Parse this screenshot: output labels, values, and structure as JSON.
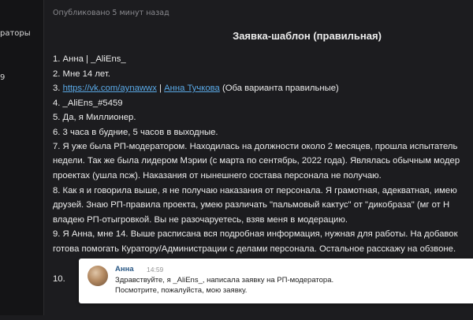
{
  "sidebar": {
    "items": [
      {
        "label": "раторы"
      },
      {
        "label": "9"
      }
    ]
  },
  "post": {
    "meta": "Опубликовано 5 минут назад",
    "title": "Заявка-шаблон (правильная)",
    "lines": [
      "1. Анна | _AliEns_",
      "2. Мне 14 лет.",
      "3. ",
      "4. _AliEns_#5459",
      "5. Да, я Миллионер.",
      "6. 3 часа в будние, 5 часов в выходные.",
      "7. Я уже была РП-модератором. Находилась на должности около 2 месяцев, прошла испытатель",
      "недели. Так же была лидером Мэрии (с марта по сентябрь, 2022 года). Являлась обычным модер",
      "проектах (ушла псж). Наказания от нынешнего состава персонала не получаю.",
      "8. Как я и говорила выше, я не получаю наказания от персонала. Я грамотная, адекватная, имею",
      "друзей. Знаю РП-правила проекта, умею различать \"пальмовый кактус\" от \"дикобраза\"  (мг от Н",
      "владею РП-отыгровкой. Вы не разочаруетесь, взяв меня в модерацию.",
      "9. Я Анна, мне 14. Выше расписана вся подробная информация, нужная для работы. На добавок",
      "готова помогать Куратору/Администрации с делами персонала. Остальное расскажу на обзвоне.",
      "10."
    ],
    "line3": {
      "link1": "https://vk.com/aynawwx",
      "sep": " | ",
      "link2": "Анна Тучкова",
      "suffix": " (Оба варианта правильные)"
    }
  },
  "popup": {
    "sender": "Анна",
    "time": "14:59",
    "message_lines": [
      "Здравствуйте, я _AliEns_, написала заявку на РП-модератора.",
      "Посмотрите, пожалуйста, мою заявку."
    ]
  }
}
